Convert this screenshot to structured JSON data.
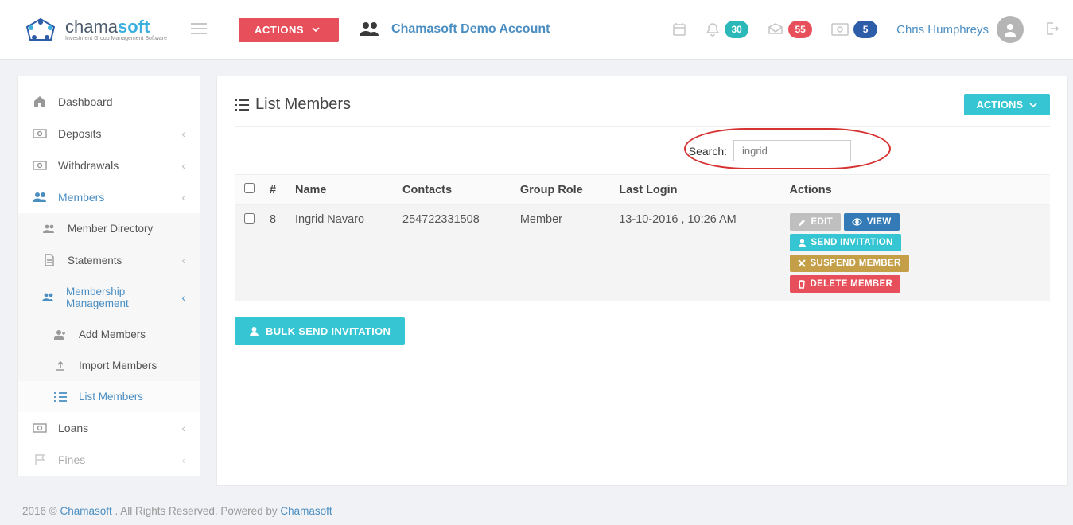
{
  "header": {
    "brand_a": "chama",
    "brand_b": "soft",
    "brand_tag": "Investment Group Management Software",
    "actions_label": "ACTIONS",
    "account_name": "Chamasoft Demo Account",
    "notif_bell": "30",
    "notif_inbox": "55",
    "notif_money": "5",
    "username": "Chris Humphreys"
  },
  "sidebar": {
    "items": [
      {
        "label": "Dashboard"
      },
      {
        "label": "Deposits"
      },
      {
        "label": "Withdrawals"
      },
      {
        "label": "Members"
      },
      {
        "label": "Member Directory"
      },
      {
        "label": "Statements"
      },
      {
        "label": "Membership Management"
      },
      {
        "label": "Add Members"
      },
      {
        "label": "Import Members"
      },
      {
        "label": "List Members"
      },
      {
        "label": "Loans"
      },
      {
        "label": "Fines"
      }
    ]
  },
  "page": {
    "title": "List Members",
    "actions_label": "ACTIONS",
    "search_label": "Search:",
    "search_value": "ingrid",
    "columns": [
      "#",
      "Name",
      "Contacts",
      "Group Role",
      "Last Login",
      "Actions"
    ],
    "rows": [
      {
        "num": "8",
        "name": "Ingrid Navaro",
        "contacts": "254722331508",
        "role": "Member",
        "last_login": "13-10-2016 , 10:26 AM"
      }
    ],
    "row_actions": {
      "edit": "EDIT",
      "view": "VIEW",
      "invite": "SEND INVITATION",
      "suspend": "SUSPEND MEMBER",
      "delete": "DELETE MEMBER"
    },
    "bulk_label": "BULK SEND INVITATION"
  },
  "footer": {
    "year": "2016 © ",
    "link1": "Chamasoft",
    "mid": ". All Rights Reserved. Powered by ",
    "link2": "Chamasoft"
  }
}
